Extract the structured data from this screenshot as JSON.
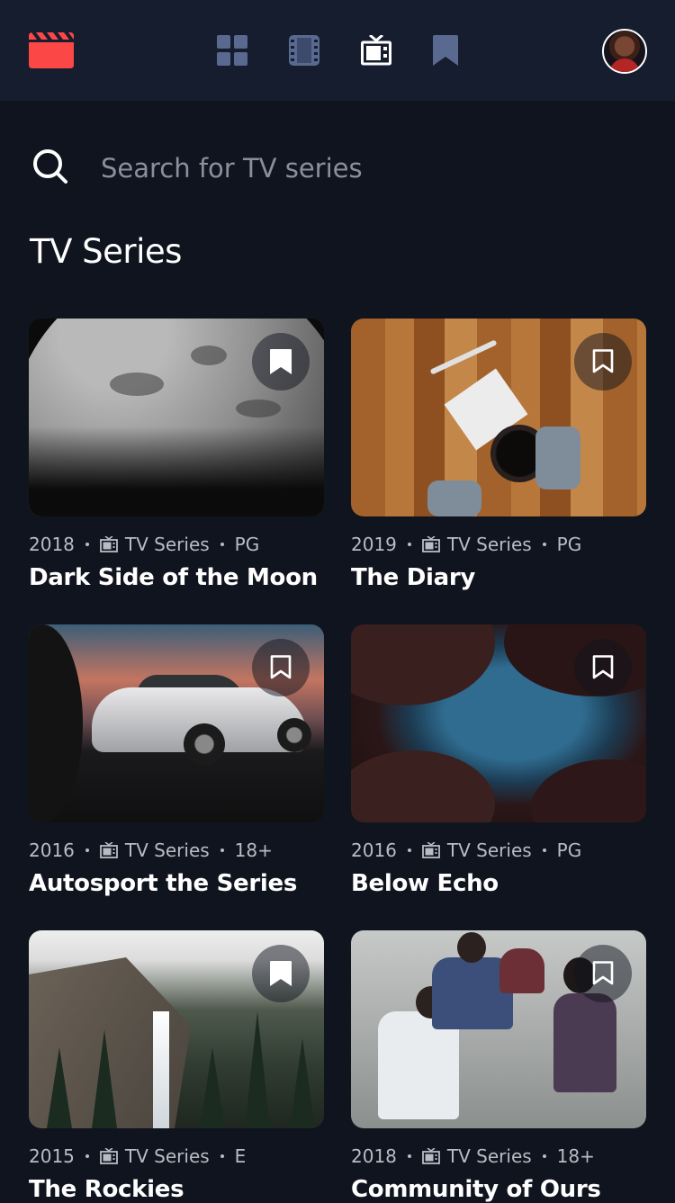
{
  "app": {
    "nav": [
      "home",
      "movies",
      "tv-series",
      "bookmarks"
    ],
    "active_nav": "tv-series",
    "colors": {
      "accent": "#FC4747",
      "background": "#10141E",
      "topbar": "#161D2F",
      "nav_inactive": "#5A698F"
    }
  },
  "search": {
    "placeholder": "Search for TV series",
    "value": ""
  },
  "section": {
    "title": "TV Series"
  },
  "shows": [
    {
      "year": "2018",
      "category": "TV Series",
      "rating": "PG",
      "title": "Dark Side of the Moon",
      "bookmarked": true
    },
    {
      "year": "2019",
      "category": "TV Series",
      "rating": "PG",
      "title": "The Diary",
      "bookmarked": false
    },
    {
      "year": "2016",
      "category": "TV Series",
      "rating": "18+",
      "title": "Autosport the Series",
      "bookmarked": false
    },
    {
      "year": "2016",
      "category": "TV Series",
      "rating": "PG",
      "title": "Below Echo",
      "bookmarked": false
    },
    {
      "year": "2015",
      "category": "TV Series",
      "rating": "E",
      "title": "The Rockies",
      "bookmarked": true
    },
    {
      "year": "2018",
      "category": "TV Series",
      "rating": "18+",
      "title": "Community of Ours",
      "bookmarked": false
    }
  ]
}
